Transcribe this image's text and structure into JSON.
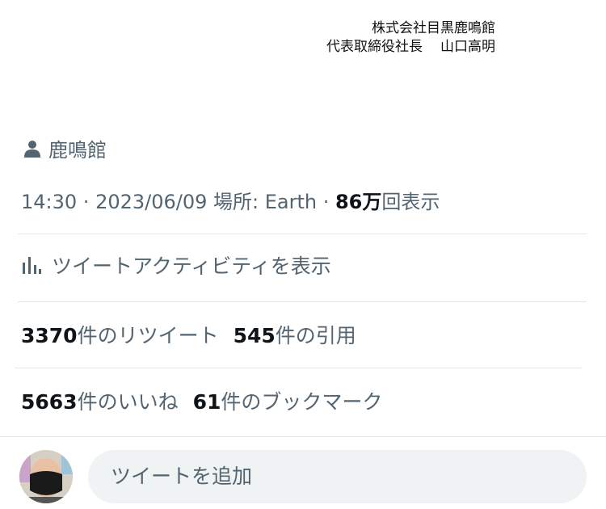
{
  "signature": {
    "company": "株式会社目黒鹿鳴館",
    "title": "代表取締役社長",
    "name": "山口高明"
  },
  "location_line": {
    "icon": "person-icon",
    "text": "鹿鳴館"
  },
  "meta": {
    "time": "14:30",
    "sep1": " · ",
    "date": "2023/06/09",
    "place": " 場所: Earth",
    "sep2": " · ",
    "views_count": "86万",
    "views_label": "回表示"
  },
  "activity": {
    "icon": "analytics-icon",
    "label": "ツイートアクティビティを表示"
  },
  "stats": {
    "retweets_count": "3370",
    "retweets_label": "件のリツイート",
    "quotes_count": "545",
    "quotes_label": "件の引用",
    "likes_count": "5663",
    "likes_label": "件のいいね",
    "bookmarks_count": "61",
    "bookmarks_label": "件のブックマーク"
  },
  "reply": {
    "placeholder": "ツイートを追加"
  }
}
